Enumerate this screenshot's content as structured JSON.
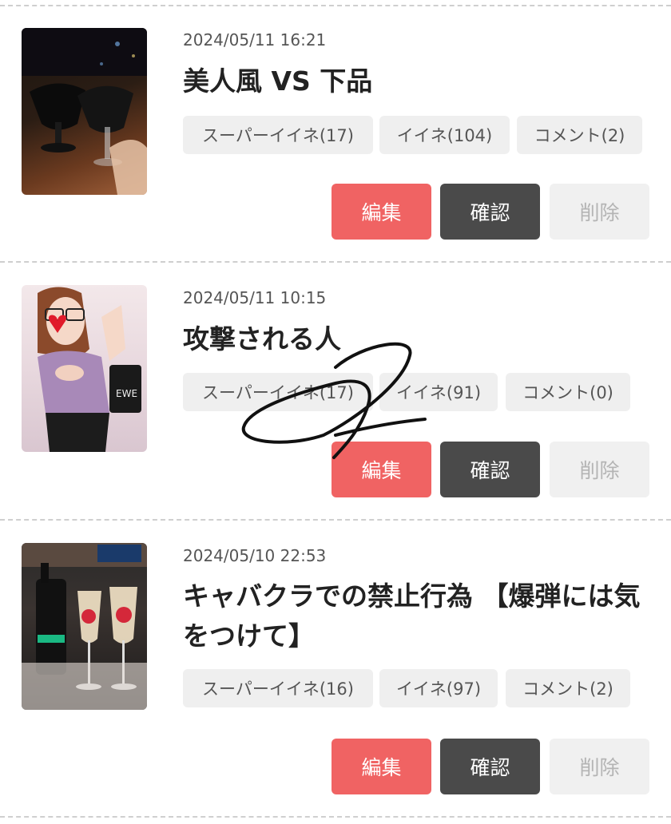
{
  "posts": [
    {
      "date": "2024/05/11 16:21",
      "title": "美人風 VS 下品",
      "super_like": "スーパーイイネ(17)",
      "like": "イイネ(104)",
      "comment": "コメント(2)",
      "edit": "編集",
      "confirm": "確認",
      "delete": "削除"
    },
    {
      "date": "2024/05/11 10:15",
      "title": "攻撃される人",
      "super_like": "スーパーイイネ(17)",
      "like": "イイネ(91)",
      "comment": "コメント(0)",
      "edit": "編集",
      "confirm": "確認",
      "delete": "削除"
    },
    {
      "date": "2024/05/10 22:53",
      "title": "キャバクラでの禁止行為 【爆弾には気をつけて】",
      "super_like": "スーパーイイネ(16)",
      "like": "イイネ(97)",
      "comment": "コメント(2)",
      "edit": "編集",
      "confirm": "確認",
      "delete": "削除"
    }
  ],
  "colors": {
    "edit_button": "#f06363",
    "confirm_button": "#4a4a4a",
    "delete_button": "#f0f0f0",
    "tag_background": "#efefef"
  }
}
